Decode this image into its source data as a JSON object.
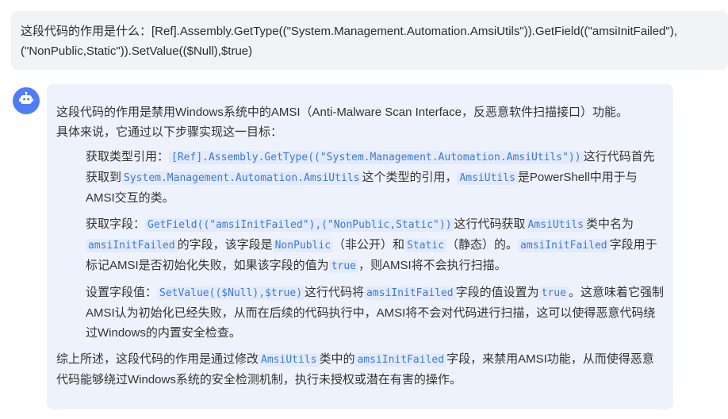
{
  "user_message": {
    "line1": "这段代码的作用是什么：[Ref].Assembly.GetType((\"System.Management.Automation.AmsiUtils\")).GetField((\"amsiInitFailed\"),",
    "line2": "(\"NonPublic,Static\")).SetValue(($Null),$true)"
  },
  "assistant_icon": "robot-icon",
  "assistant_message": {
    "intro_1": "这段代码的作用是禁用Windows系统中的AMSI（Anti-Malware Scan Interface，反恶意软件扫描接口）功能。",
    "intro_2": "具体来说，它通过以下步骤实现这一目标：",
    "step1": {
      "t1": "获取类型引用：",
      "c1": "[Ref].Assembly.GetType((\"System.Management.Automation.AmsiUtils\"))",
      "t2": "这行代码首先获取到",
      "c2": "System.Management.Automation.AmsiUtils",
      "t3": "这个类型的引用，",
      "c3": "AmsiUtils",
      "t4": "是PowerShell中用于与AMSI交互的类。"
    },
    "step2": {
      "t1": "获取字段：",
      "c1": "GetField((\"amsiInitFailed\"),(\"NonPublic,Static\"))",
      "t2": "这行代码获取",
      "c2": "AmsiUtils",
      "t3": "类中名为",
      "c3": "amsiInitFailed",
      "t4": "的字段，该字段是",
      "c4": "NonPublic",
      "t5": "（非公开）和",
      "c5": "Static",
      "t6": "（静态）的。",
      "c6": "amsiInitFailed",
      "t7": "字段用于标记AMSI是否初始化失败，如果该字段的值为",
      "c7": "true",
      "t8": "，则AMSI将不会执行扫描。"
    },
    "step3": {
      "t1": "设置字段值：",
      "c1": "SetValue(($Null),$true)",
      "t2": "这行代码将",
      "c2": "amsiInitFailed",
      "t3": "字段的值设置为",
      "c3": "true",
      "t4": "。这意味着它强制AMSI认为初始化已经失败，从而在后续的代码执行中，AMSI将不会对代码进行扫描，这可以使得恶意代码绕过Windows的内置安全检查。"
    },
    "summary": {
      "t1": "综上所述，这段代码的作用是通过修改",
      "c1": "AmsiUtils",
      "t2": "类中的",
      "c2": "amsiInitFailed",
      "t3": "字段，来禁用AMSI功能，从而使得恶意代码能够绕过Windows系统的安全检测机制，执行未授权或潜在有害的操作。"
    }
  }
}
